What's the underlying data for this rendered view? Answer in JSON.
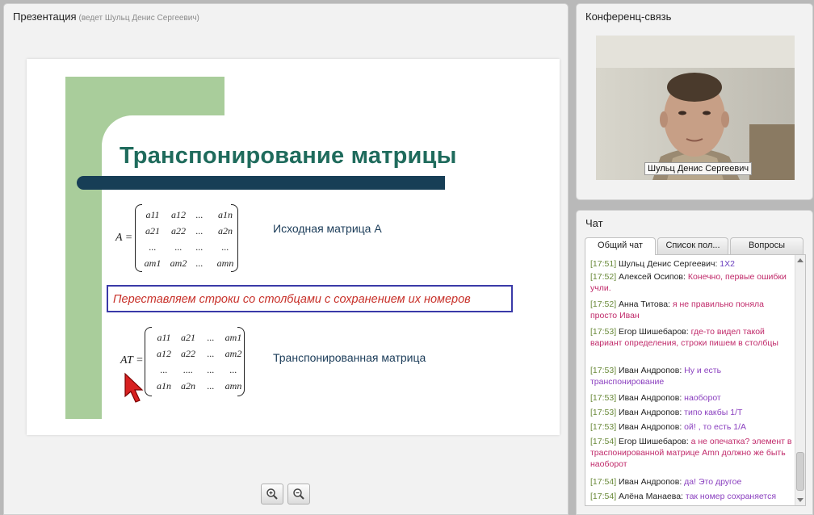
{
  "presentation": {
    "title": "Презентация",
    "presenter_note": "(ведет Шульц Денис Сергеевич)"
  },
  "slide": {
    "title": "Транспонирование матрицы",
    "original_label": "Исходная матрица А",
    "highlight": "Переставляем строки со столбцами с сохранением их номеров",
    "transposed_label": "Транспонированная матрица",
    "matrix_a_name": "A =",
    "matrix_a": [
      [
        "a11",
        "a12",
        "...",
        "a1n"
      ],
      [
        "a21",
        "a22",
        "...",
        "a2n"
      ],
      [
        "...",
        "...",
        "...",
        "..."
      ],
      [
        "am1",
        "am2",
        "...",
        "amn"
      ]
    ],
    "matrix_t_name": "AT =",
    "matrix_t": [
      [
        "a11",
        "a21",
        "...",
        "am1"
      ],
      [
        "a12",
        "a22",
        "...",
        "am2"
      ],
      [
        "...",
        "....",
        "...",
        "..."
      ],
      [
        "a1n",
        "a2n",
        "...",
        "amn"
      ]
    ]
  },
  "zoom": {
    "in_icon": "zoom-in-icon",
    "out_icon": "zoom-out-icon"
  },
  "conference": {
    "title": "Конференц-связь",
    "speaker_name": "Шульц Денис Сергеевич"
  },
  "chat": {
    "title": "Чат",
    "tabs": [
      "Общий чат",
      "Список пол...",
      "Вопросы"
    ],
    "messages": [
      {
        "time": "[17:51]",
        "author": "Шульц Денис Сергеевич:",
        "text": "1Х2",
        "color": "#6a3fbf"
      },
      {
        "time": "[17:52]",
        "author": "Алексей Осипов:",
        "text": "Конечно, первые ошибки учли.",
        "color": "#c02a6a"
      },
      {
        "time": "[17:52]",
        "author": "Анна Титова:",
        "text": "я не правильно поняла просто    Иван",
        "color": "#c02a6a"
      },
      {
        "time": "[17:53]",
        "author": "Егор Шишебаров:",
        "text": "где-то видел такой вариант определения, строки пишем в столбцы",
        "color": "#c02a6a"
      },
      {
        "time": "[17:53]",
        "author": "Иван Андропов:",
        "text": "Ну и есть транспонирование",
        "color": "#8a3fbf"
      },
      {
        "time": "[17:53]",
        "author": "Иван Андропов:",
        "text": "наоборот",
        "color": "#8a3fbf"
      },
      {
        "time": "[17:53]",
        "author": "Иван Андропов:",
        "text": "типо какбы 1/T",
        "color": "#8a3fbf"
      },
      {
        "time": "[17:53]",
        "author": "Иван Андропов:",
        "text": "ой! , то есть 1/A",
        "color": "#8a3fbf"
      },
      {
        "time": "[17:54]",
        "author": "Егор Шишебаров:",
        "text": "а не опечатка? элемент в траспонированной матрице Amn должно же быть наоборот",
        "color": "#c02a6a"
      },
      {
        "time": "[17:54]",
        "author": "Иван Андропов:",
        "text": "да! Это другое",
        "color": "#8a3fbf"
      },
      {
        "time": "[17:54]",
        "author": "Алёна Манаева:",
        "text": "так номер сохраняется",
        "color": "#8a3fbf"
      }
    ]
  },
  "colors": {
    "slide_green": "#a9cd9b",
    "slide_title": "#1f6b5c",
    "highlight_text": "#c8312a",
    "timestamp": "#6a8a3a"
  }
}
